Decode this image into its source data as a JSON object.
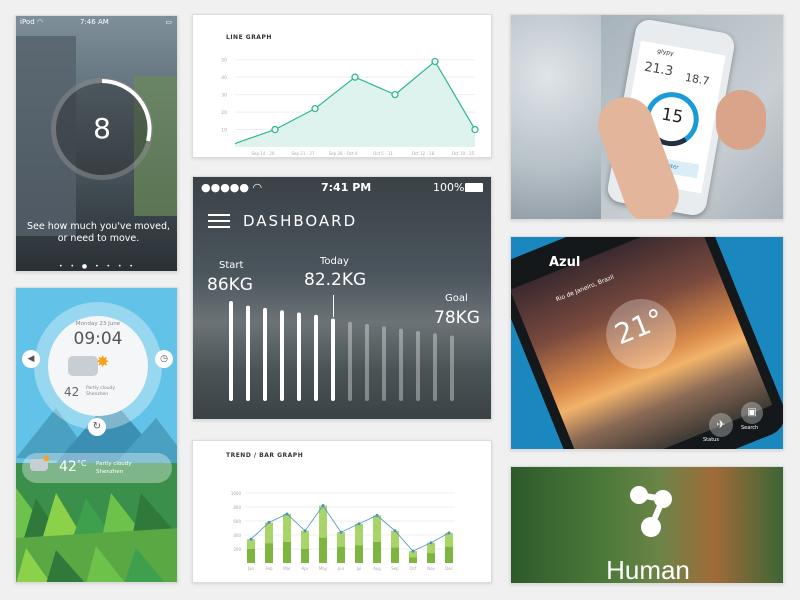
{
  "activity_app": {
    "status_device": "iPod",
    "status_time": "7:46 AM",
    "ring_value": "8",
    "caption": "See how much you've moved, or need to move."
  },
  "line_graph": {
    "title": "LINE GRAPH",
    "chart_data": {
      "type": "line",
      "title": "LINE GRAPH",
      "categories": [
        "Sep 14 - 20",
        "Sep 21 - 27",
        "Sep 28 - Oct 4",
        "Oct 5 - 11",
        "Oct 12 - 18",
        "Oct 19 - 25"
      ],
      "x": [
        0,
        1,
        2,
        3,
        4,
        5,
        6
      ],
      "values": [
        2,
        10,
        22,
        40,
        30,
        49,
        10
      ],
      "y_ticks": [
        "10",
        "20",
        "30",
        "40",
        "50"
      ],
      "ylim": [
        0,
        55
      ],
      "grid": true
    }
  },
  "dashboard": {
    "status_time": "7:41 PM",
    "battery": "100%",
    "title": "DASHBOARD",
    "start_label": "Start",
    "start_value": "86KG",
    "today_label": "Today",
    "today_value": "82.2KG",
    "goal_label": "Goal",
    "goal_value": "78KG",
    "chart_data": {
      "type": "bar",
      "values": [
        86,
        85,
        84.5,
        84,
        83.5,
        83,
        82.2,
        81.5,
        81,
        80.5,
        80,
        79.5,
        79,
        78.5
      ],
      "highlighted_count": 7
    }
  },
  "phone_app": {
    "app_name": "glypy",
    "left_value": "21.3",
    "right_value": "18.7",
    "center_value": "15",
    "button_label": "82% Water"
  },
  "weather_clock": {
    "date": "Monday 23 June",
    "time": "09:04",
    "temp": "42",
    "condition": "Partly cloudy",
    "city": "Shenzhen",
    "bottom_temp": "42",
    "bottom_unit": "°C",
    "bottom_condition": "Partly cloudy",
    "bottom_city": "Shenzhen"
  },
  "bar_graph": {
    "title": "TREND / BAR GRAPH",
    "chart_data": {
      "type": "bar",
      "title": "TREND / BAR GRAPH",
      "categories": [
        "Jan",
        "Feb",
        "Mar",
        "Apr",
        "May",
        "Jun",
        "Jul",
        "Aug",
        "Sep",
        "Oct",
        "Nov",
        "Dec"
      ],
      "y_ticks": [
        "200",
        "400",
        "600",
        "800",
        "1000"
      ],
      "ylim": [
        0,
        1000
      ],
      "series": [
        {
          "values": [
            200,
            280,
            300,
            200,
            360,
            230,
            250,
            300,
            220,
            80,
            140,
            230
          ]
        },
        {
          "values": [
            340,
            580,
            700,
            460,
            820,
            440,
            560,
            680,
            460,
            170,
            290,
            430
          ]
        }
      ],
      "trend": [
        340,
        580,
        700,
        460,
        820,
        440,
        560,
        680,
        460,
        170,
        290,
        430
      ]
    }
  },
  "weather_app": {
    "brand": "Azul",
    "location": "Rio de Janeiro, Brazil",
    "temp": "21°",
    "status_label": "Status",
    "search_label": "Search"
  },
  "human": {
    "label": "Human"
  }
}
